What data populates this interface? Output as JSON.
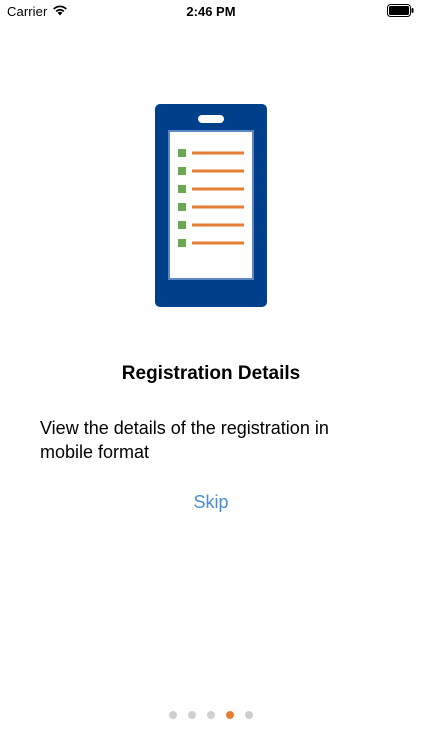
{
  "status_bar": {
    "carrier": "Carrier",
    "time": "2:46 PM"
  },
  "onboarding": {
    "title": "Registration Details",
    "description": "View the details of the registration in mobile format",
    "skip_label": "Skip",
    "page_count": 5,
    "current_page": 4
  },
  "colors": {
    "phone_frame": "#003f8a",
    "phone_screen_border": "#5e86c2",
    "bullet": "#6aa84f",
    "line": "#e67e35",
    "link": "#4a8fd2",
    "dot_inactive": "#cfcfcf",
    "dot_active": "#e67e35"
  },
  "icons": {
    "wifi": "wifi-icon",
    "battery": "battery-icon",
    "phone_checklist": "phone-checklist-illustration"
  }
}
